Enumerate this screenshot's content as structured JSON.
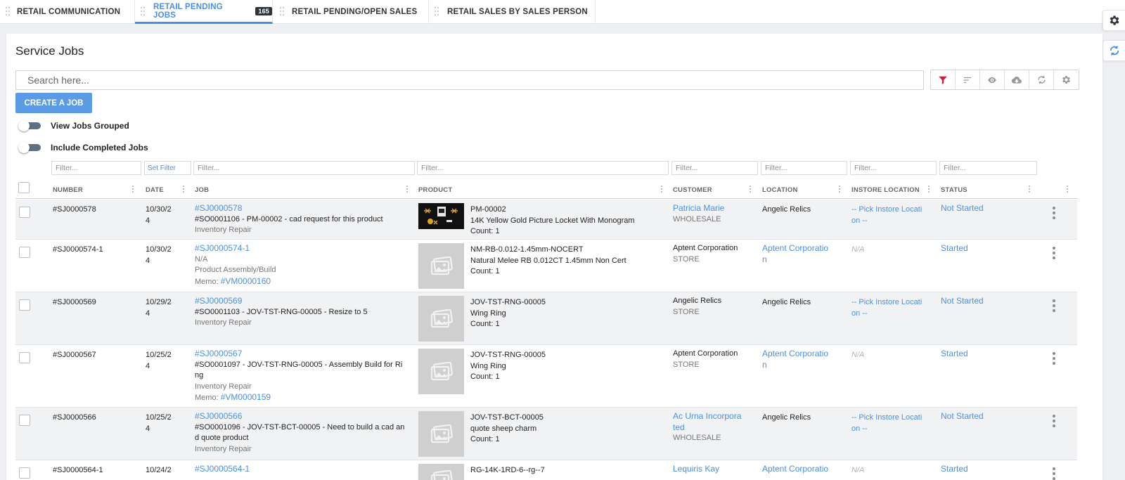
{
  "tabs": [
    {
      "label": "RETAIL COMMUNICATION",
      "active": false
    },
    {
      "label": "RETAIL PENDING JOBS",
      "active": true,
      "badge": "165"
    },
    {
      "label": "RETAIL PENDING/OPEN SALES",
      "active": false
    },
    {
      "label": "RETAIL SALES BY SALES PERSON",
      "active": false
    }
  ],
  "side_buttons": [
    {
      "icon": "gear-icon"
    },
    {
      "icon": "sync-icon"
    }
  ],
  "page_title": "Service Jobs",
  "search": {
    "placeholder": "Search here...",
    "value": ""
  },
  "toolbar": {
    "icons": [
      "filter-icon",
      "sort-icon",
      "eye-icon",
      "cloud-download-icon",
      "refresh-icon",
      "settings-icon"
    ],
    "filter_color": "#e0143c"
  },
  "create_button": "CREATE A JOB",
  "toggles": [
    {
      "label": "View Jobs Grouped",
      "on": false
    },
    {
      "label": "Include Completed Jobs",
      "on": false
    }
  ],
  "filters": {
    "placeholder": "Filter...",
    "set_filter": "Set Filter"
  },
  "columns": [
    "NUMBER",
    "DATE",
    "JOB",
    "PRODUCT",
    "CUSTOMER",
    "LOCATION",
    "INSTORE LOCATION",
    "STATUS"
  ],
  "rows": [
    {
      "number": "#SJ0000578",
      "date": [
        "10/30/2",
        "4"
      ],
      "job_link": "#SJ0000578",
      "job_lines": [
        "#SO0001106 - PM-00002 - cad request for this product"
      ],
      "job_type": "Inventory Repair",
      "memo_label": "",
      "memo_link": "",
      "has_image": true,
      "product_lines": [
        "PM-00002",
        "14K Yellow Gold Picture Locket With Monogram",
        "Count: 1"
      ],
      "customer_name": [
        "Patricia Marie"
      ],
      "customer_is_link": true,
      "customer_type": "WHOLESALE",
      "location": [
        "Angelic Relics"
      ],
      "location_is_link": false,
      "instore": [
        "-- Pick Instore Locati",
        "on --"
      ],
      "instore_na": false,
      "status": "Not Started"
    },
    {
      "number": "#SJ0000574-1",
      "date": [
        "10/30/2",
        "4"
      ],
      "job_link": "#SJ0000574-1",
      "job_lines": [
        "N/A"
      ],
      "job_lines_muted": true,
      "job_type": "Product Assembly/Build",
      "memo_label": "Memo:",
      "memo_link": "#VM0000160",
      "has_image": false,
      "product_lines": [
        "NM-RB-0.012-1.45mm-NOCERT",
        "Natural Melee RB 0.012CT 1.45mm Non Cert",
        "Count: 1"
      ],
      "customer_name": [
        "Aptent Corporation"
      ],
      "customer_is_link": false,
      "customer_type": "STORE",
      "location": [
        "Aptent Corporatio",
        "n"
      ],
      "location_is_link": true,
      "instore": [
        "N/A"
      ],
      "instore_na": true,
      "status": "Started"
    },
    {
      "number": "#SJ0000569",
      "date": [
        "10/29/2",
        "4"
      ],
      "job_link": "#SJ0000569",
      "job_lines": [
        "#SO0001103 - JOV-TST-RNG-00005 - Resize to 5"
      ],
      "job_type": "Inventory Repair",
      "memo_label": "",
      "memo_link": "",
      "has_image": false,
      "product_lines": [
        "JOV-TST-RNG-00005",
        "Wing Ring",
        "Count: 1"
      ],
      "customer_name": [
        "Angelic Relics"
      ],
      "customer_is_link": false,
      "customer_type": "STORE",
      "location": [
        "Angelic Relics"
      ],
      "location_is_link": false,
      "instore": [
        "-- Pick Instore Locati",
        "on --"
      ],
      "instore_na": false,
      "status": "Not Started"
    },
    {
      "number": "#SJ0000567",
      "date": [
        "10/25/2",
        "4"
      ],
      "job_link": "#SJ0000567",
      "job_lines": [
        "#SO0001097 - JOV-TST-RNG-00005 - Assembly Build for Ri",
        "ng"
      ],
      "job_type": "Inventory Repair",
      "memo_label": "Memo:",
      "memo_link": "#VM0000159",
      "has_image": false,
      "product_lines": [
        "JOV-TST-RNG-00005",
        "Wing Ring",
        "Count: 1"
      ],
      "customer_name": [
        "Aptent Corporation"
      ],
      "customer_is_link": false,
      "customer_type": "STORE",
      "location": [
        "Aptent Corporatio",
        "n"
      ],
      "location_is_link": true,
      "instore": [
        "N/A"
      ],
      "instore_na": true,
      "status": "Started"
    },
    {
      "number": "#SJ0000566",
      "date": [
        "10/25/2",
        "4"
      ],
      "job_link": "#SJ0000566",
      "job_lines": [
        "#SO0001096 - JOV-TST-BCT-00005 - Need to build a cad an",
        "d quote product"
      ],
      "job_type": "Inventory Repair",
      "memo_label": "",
      "memo_link": "",
      "has_image": false,
      "product_lines": [
        "JOV-TST-BCT-00005",
        "quote sheep charm",
        "Count: 1"
      ],
      "customer_name": [
        "Ac Urna Incorpora",
        "ted"
      ],
      "customer_is_link": true,
      "customer_type": "WHOLESALE",
      "location": [
        "Angelic Relics"
      ],
      "location_is_link": false,
      "instore": [
        "-- Pick Instore Locati",
        "on --"
      ],
      "instore_na": false,
      "status": "Not Started"
    },
    {
      "number": "#SJ0000564-1",
      "date": [
        "10/24/2",
        ""
      ],
      "job_link": "#SJ0000564-1",
      "job_lines": [],
      "job_type": "",
      "memo_label": "",
      "memo_link": "",
      "has_image": false,
      "product_lines": [
        "RG-14K-1RD-6--rg--7"
      ],
      "customer_name": [
        "Lequiris Kay"
      ],
      "customer_is_link": true,
      "customer_type": "",
      "location": [
        "Aptent Corporatio"
      ],
      "location_is_link": true,
      "instore": [
        "N/A"
      ],
      "instore_na": true,
      "status": "Started"
    }
  ]
}
